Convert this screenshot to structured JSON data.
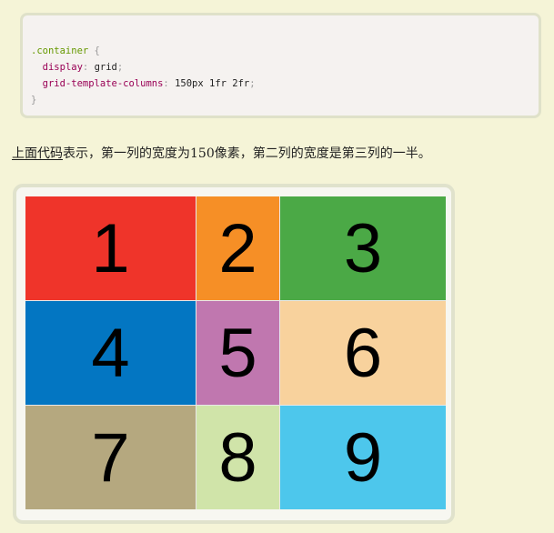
{
  "code": {
    "selector": ".container",
    "open_brace": "{",
    "close_brace": "}",
    "lines": [
      {
        "prop": "display",
        "value": "grid"
      },
      {
        "prop": "grid-template-columns",
        "value": "150px 1fr 2fr"
      }
    ]
  },
  "description": {
    "link_text": "上面代码",
    "text": "表示，第一列的宽度为150像素，第二列的宽度是第三列的一半。"
  },
  "grid": {
    "items": [
      {
        "label": "1",
        "color": "#ef342a"
      },
      {
        "label": "2",
        "color": "#f68f26"
      },
      {
        "label": "3",
        "color": "#4ba946"
      },
      {
        "label": "4",
        "color": "#0376c2"
      },
      {
        "label": "5",
        "color": "#c077af"
      },
      {
        "label": "6",
        "color": "#f8d29d"
      },
      {
        "label": "7",
        "color": "#b5a87f"
      },
      {
        "label": "8",
        "color": "#d0e4a9"
      },
      {
        "label": "9",
        "color": "#4dc7ec"
      }
    ]
  }
}
